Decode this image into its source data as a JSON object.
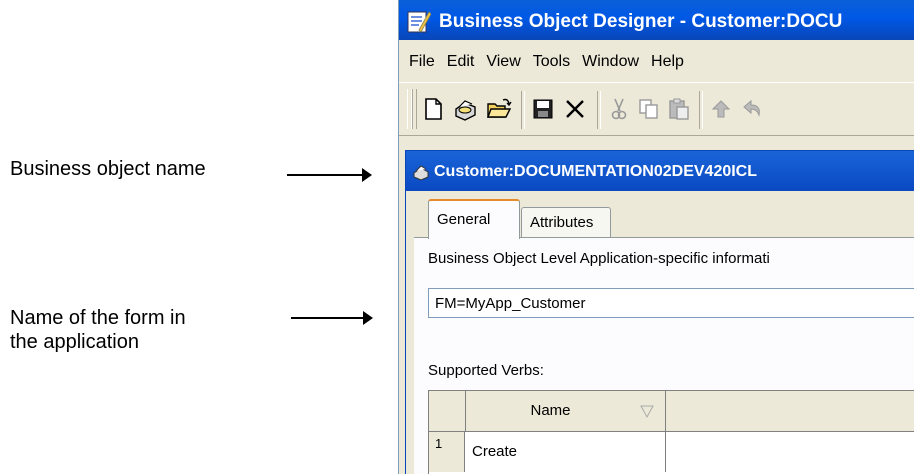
{
  "callouts": {
    "business_object_name": "Business object name",
    "form_name_line1": "Name of the form in",
    "form_name_line2": "the application"
  },
  "window": {
    "title": "Business Object Designer - Customer:DOCU"
  },
  "menu": [
    "File",
    "Edit",
    "View",
    "Tools",
    "Window",
    "Help"
  ],
  "toolbar_icons": [
    "new-document-icon",
    "print-icon",
    "open-folder-icon",
    "save-icon",
    "delete-icon",
    "cut-icon",
    "copy-icon",
    "paste-icon",
    "move-up-icon"
  ],
  "document": {
    "title": "Customer:DOCUMENTATION02DEV420ICL",
    "tabs": [
      {
        "label": "General",
        "active": true
      },
      {
        "label": "Attributes",
        "active": false
      }
    ],
    "app_info_label": "Business Object Level Application-specific informati",
    "app_info_value": "FM=MyApp_Customer",
    "verbs_label": "Supported Verbs:",
    "verbs_table": {
      "columns": [
        "Name"
      ],
      "rows": [
        {
          "num": "1",
          "name": "Create"
        }
      ]
    }
  },
  "colors": {
    "titlebar": "#0058e6",
    "window_bg": "#ece9d8"
  }
}
